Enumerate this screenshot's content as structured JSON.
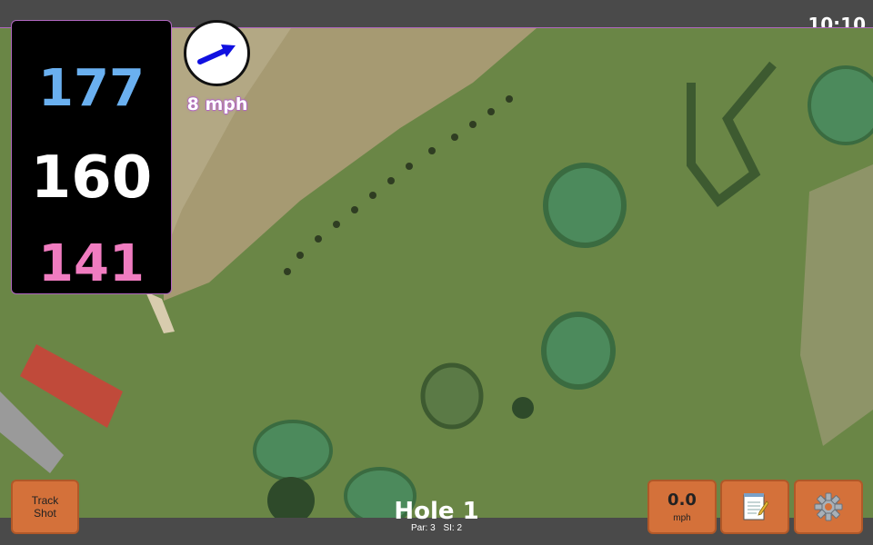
{
  "status_bar": {
    "time": "10:10"
  },
  "distances": {
    "back": "177",
    "middle": "160",
    "front": "141"
  },
  "wind": {
    "speed_label": "8 mph",
    "icon": "wind-arrow-icon"
  },
  "hole": {
    "title": "Hole 1",
    "par_label": "Par: 3",
    "si_label": "SI: 2"
  },
  "buttons": {
    "track_shot": {
      "line1": "Track",
      "line2": "Shot"
    },
    "speed": {
      "value": "0.0",
      "unit": "mph"
    },
    "notes": {
      "icon": "notepad-icon"
    },
    "settings": {
      "icon": "gear-icon"
    }
  },
  "colors": {
    "back": "#6ab0f0",
    "middle": "#ffffff",
    "front": "#f07cc0",
    "accent": "#b066c0",
    "button": "#d4713a"
  }
}
